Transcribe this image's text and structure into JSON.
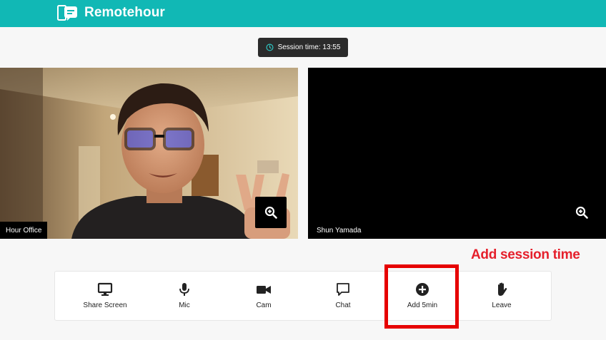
{
  "app": {
    "brand_name": "Remotehour",
    "brand_color": "#11b8b5"
  },
  "session": {
    "label": "Session time: 13:55"
  },
  "videos": [
    {
      "name": "Hour Office"
    },
    {
      "name": "Shun Yamada"
    }
  ],
  "toolbar": {
    "items": [
      {
        "label": "Share Screen",
        "icon": "monitor-icon"
      },
      {
        "label": "Mic",
        "icon": "microphone-icon"
      },
      {
        "label": "Cam",
        "icon": "video-camera-icon"
      },
      {
        "label": "Chat",
        "icon": "chat-bubble-icon"
      },
      {
        "label": "Add 5min",
        "icon": "plus-circle-icon"
      },
      {
        "label": "Leave",
        "icon": "hand-icon"
      }
    ]
  },
  "annotation": {
    "text": "Add session time",
    "color": "#e5202c"
  }
}
